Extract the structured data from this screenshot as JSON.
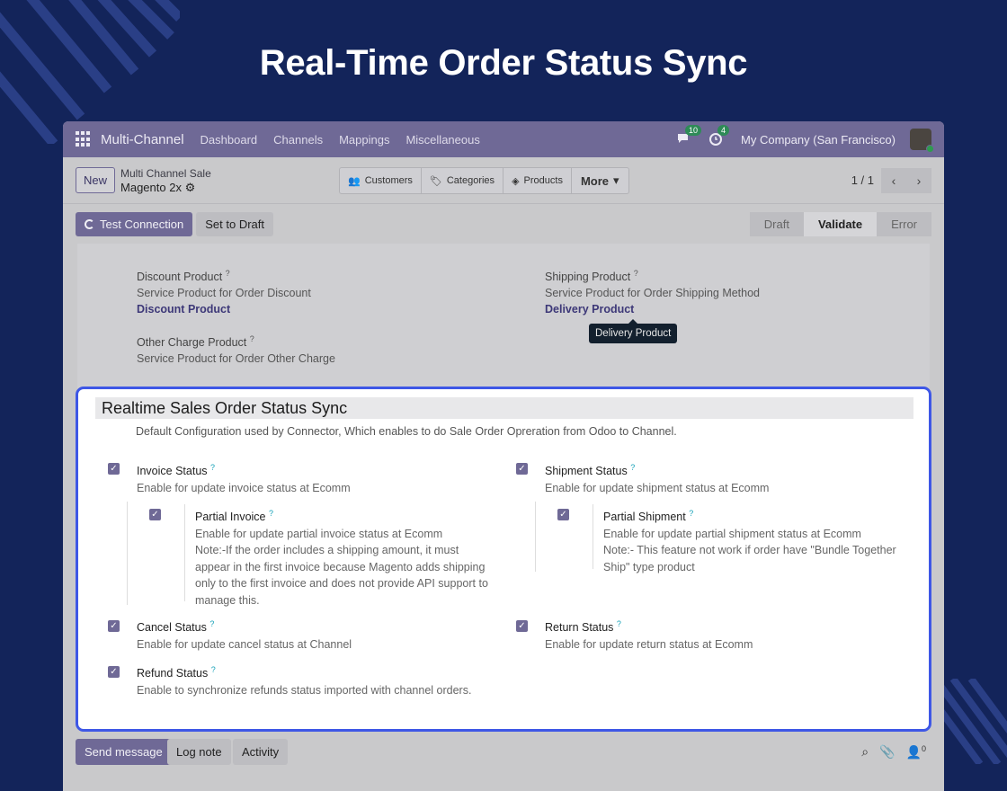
{
  "hero": {
    "title": "Real-Time Order Status Sync"
  },
  "navbar": {
    "brand": "Multi-Channel",
    "items": [
      "Dashboard",
      "Channels",
      "Mappings",
      "Miscellaneous"
    ],
    "messages_count": "10",
    "activities_count": "4",
    "company": "My Company (San Francisco)"
  },
  "control": {
    "new_label": "New",
    "breadcrumb_parent": "Multi Channel Sale",
    "record_name": "Magento 2x",
    "smart_buttons": [
      "Customers",
      "Categories",
      "Products"
    ],
    "more_label": "More",
    "pager": "1 / 1"
  },
  "status": {
    "test_connection": "Test Connection",
    "set_to_draft": "Set to Draft",
    "stages": [
      "Draft",
      "Validate",
      "Error"
    ],
    "active_stage": "Validate"
  },
  "form": {
    "discount": {
      "label": "Discount Product",
      "help": "Service Product for Order Discount",
      "value": "Discount Product"
    },
    "shipping": {
      "label": "Shipping Product",
      "help": "Service Product for Order Shipping Method",
      "value": "Delivery Product"
    },
    "other": {
      "label": "Other Charge Product",
      "help": "Service Product for Order Other Charge"
    },
    "tooltip": "Delivery Product"
  },
  "panel": {
    "title": "Realtime Sales Order Status Sync",
    "description": "Default Configuration used by Connector, Which enables to do Sale Order Opreration from Odoo to Channel.",
    "invoice": {
      "label": "Invoice Status",
      "help": "Enable for update invoice status at Ecomm"
    },
    "partial_invoice": {
      "label": "Partial Invoice",
      "help": "Enable for update partial invoice status at Ecomm",
      "note1": "Note:-If the order includes a shipping amount, it must",
      "note2": "appear in the first invoice because Magento adds shipping",
      "note3": "only to the first invoice and does not provide API support to",
      "note4": "manage this."
    },
    "shipment": {
      "label": "Shipment Status",
      "help": "Enable for update shipment status at Ecomm"
    },
    "partial_shipment": {
      "label": "Partial Shipment",
      "help": "Enable for update partial shipment status at Ecomm",
      "note1": "Note:- This feature not work if order have \"Bundle Together",
      "note2": "Ship\" type product"
    },
    "cancel": {
      "label": "Cancel Status",
      "help": "Enable for update cancel status at Channel"
    },
    "return": {
      "label": "Return Status",
      "help": "Enable for update return status at Ecomm"
    },
    "refund": {
      "label": "Refund Status",
      "help": "Enable to synchronize refunds status imported with channel orders."
    },
    "help_mark": "?"
  },
  "chatter": {
    "send_message": "Send message",
    "log_note": "Log note",
    "activity": "Activity",
    "followers_count": "0"
  },
  "colors": {
    "accent": "#6f6996",
    "highlight_border": "#3e57e6",
    "background": "#13245a"
  }
}
